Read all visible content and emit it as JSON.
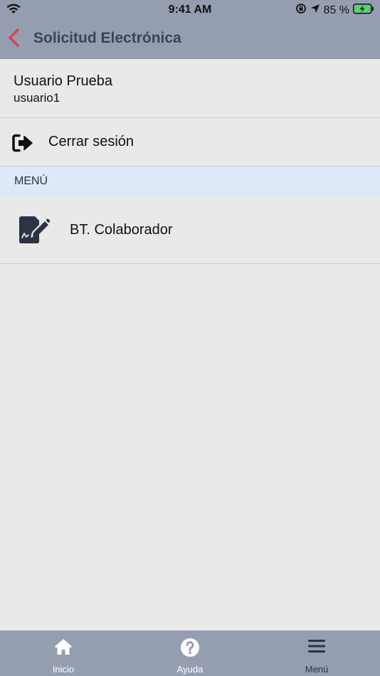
{
  "status_bar": {
    "time": "9:41 AM",
    "battery_text": "85 %",
    "icons": [
      "wifi-icon",
      "orientation-lock-icon",
      "location-icon",
      "battery-charging-icon"
    ]
  },
  "nav": {
    "title": "Solicitud Electrónica",
    "back_icon": "chevron-left-icon"
  },
  "user": {
    "name": "Usuario Prueba",
    "id": "usuario1"
  },
  "logout": {
    "label": "Cerrar sesión",
    "icon": "sign-out-icon"
  },
  "menu": {
    "header": "MENÚ",
    "items": [
      {
        "label": "BT. Colaborador",
        "icon": "document-signature-icon"
      }
    ]
  },
  "tabbar": {
    "tabs": [
      {
        "label": "Inicio",
        "icon": "home-icon"
      },
      {
        "label": "Ayuda",
        "icon": "question-circle-icon"
      },
      {
        "label": "Menú",
        "icon": "hamburger-menu-icon"
      }
    ]
  },
  "colors": {
    "bar_background": "#959eb1",
    "accent_back": "#d9414f",
    "title_text": "#3c4354",
    "menu_header_background": "#dfe8f8",
    "page_background": "#e9e9e9"
  }
}
